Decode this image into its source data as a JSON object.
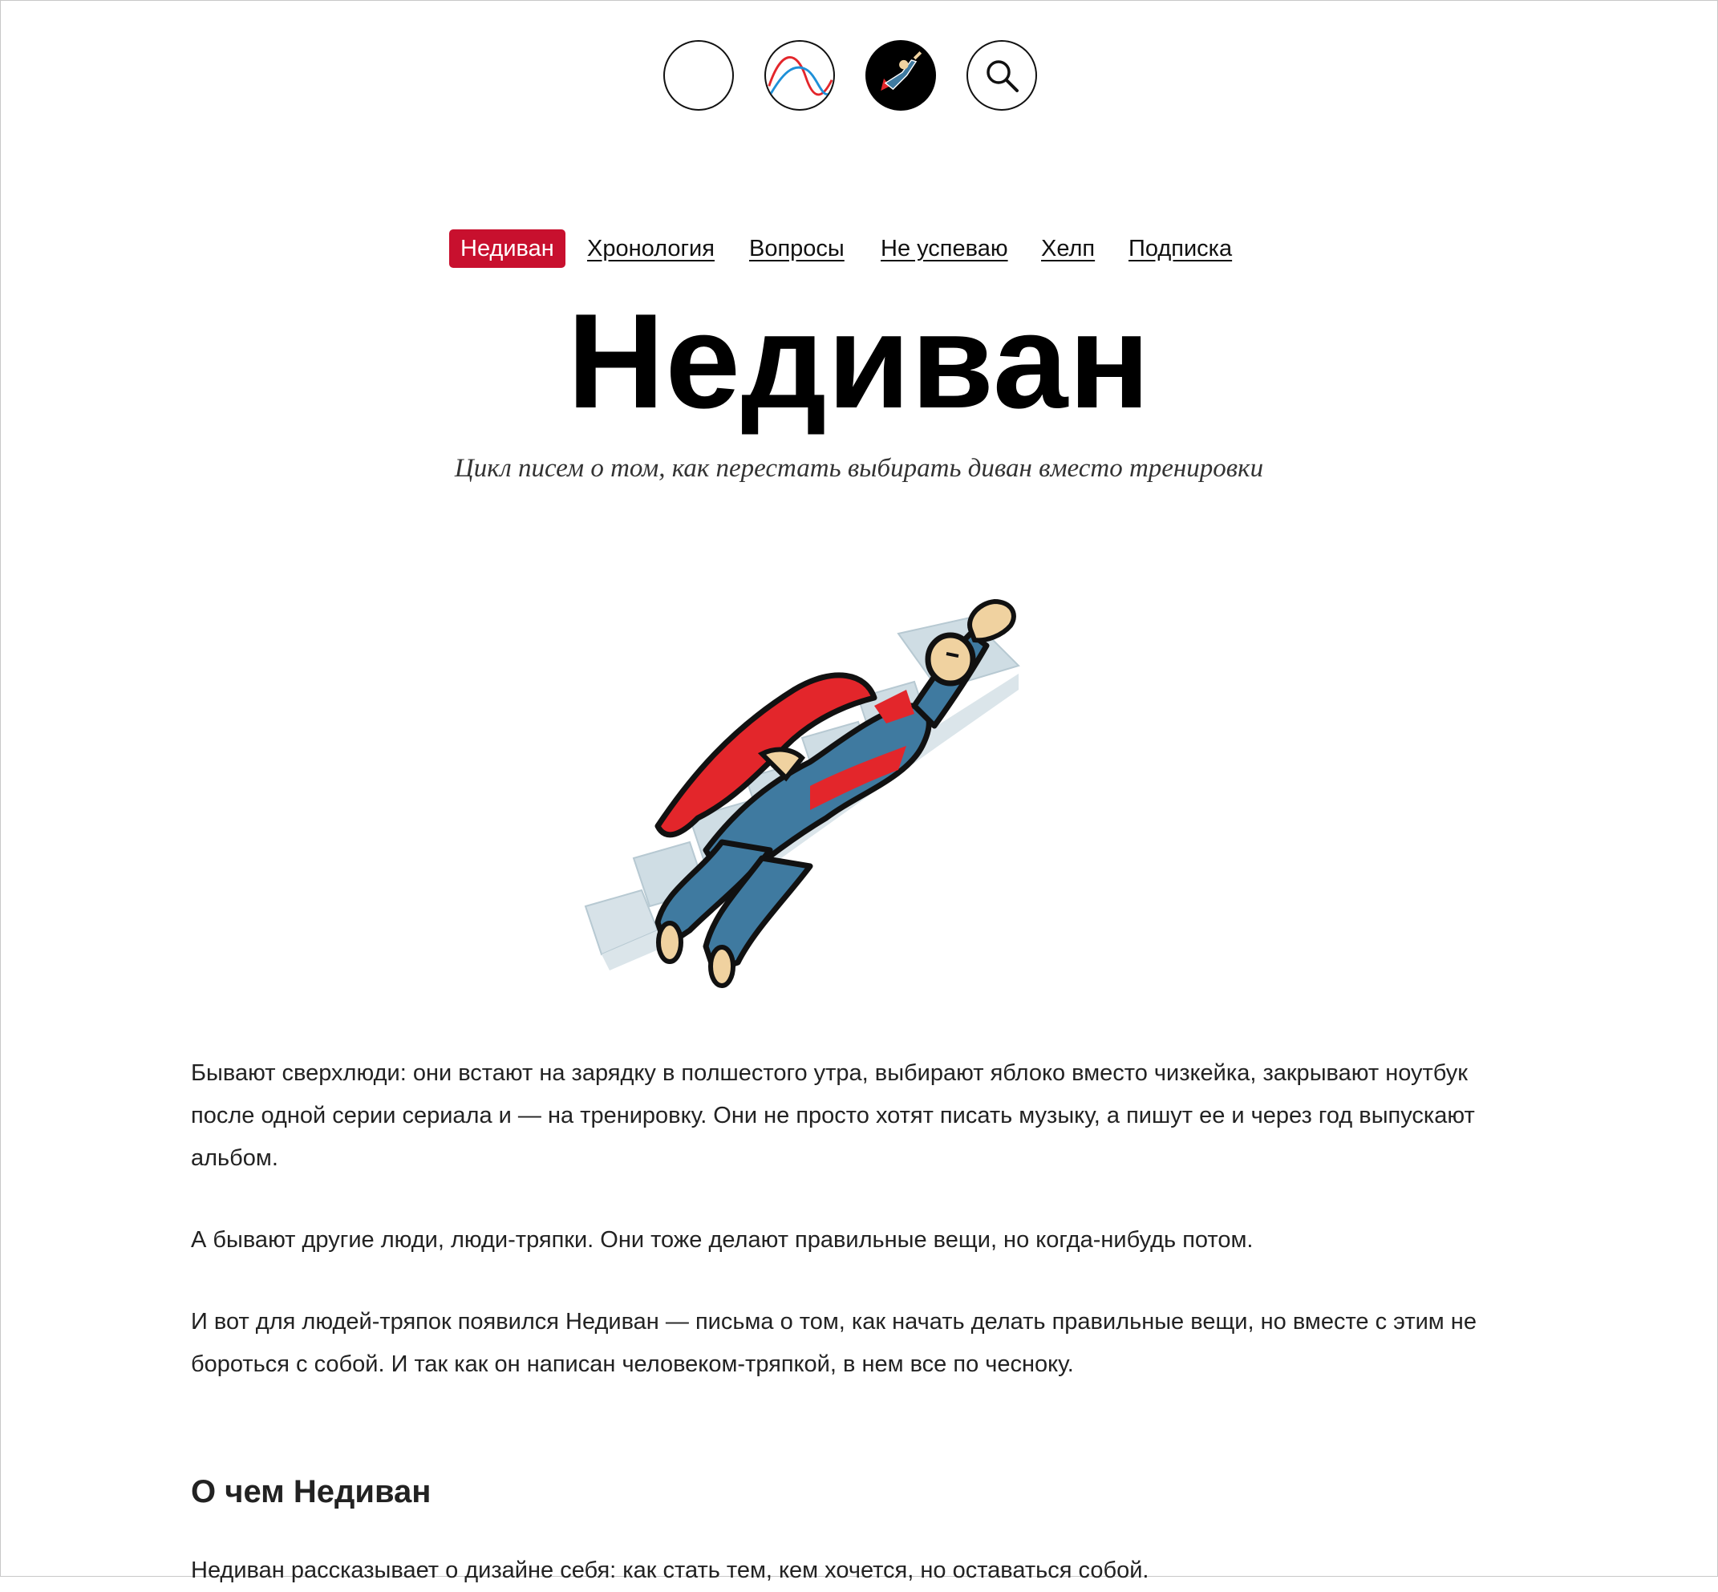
{
  "top_icons": [
    {
      "name": "blank-circle-icon"
    },
    {
      "name": "waves-chart-icon"
    },
    {
      "name": "superhero-icon"
    },
    {
      "name": "search-icon"
    }
  ],
  "nav": {
    "items": [
      {
        "label": "Недиван",
        "active": true
      },
      {
        "label": "Хронология"
      },
      {
        "label": "Вопросы"
      },
      {
        "label": "Не успеваю"
      },
      {
        "label": "Хелп"
      },
      {
        "label": "Подписка"
      }
    ]
  },
  "header": {
    "title": "Недиван",
    "subtitle": "Цикл писем о том, как перестать выбирать диван вместо тренировки"
  },
  "hero": {
    "image": "superhero-flying-up-stairs"
  },
  "content": {
    "p1": "Бывают сверхлюди: они встают на зарядку в полшестого утра, выбирают яблоко вместо чизкейка, закрывают ноутбук после одной серии сериала и — на тренировку. Они не просто хотят писать музыку, а пишут ее и через год выпускают альбом.",
    "p2": "А бывают другие люди, люди-тряпки. Они тоже делают правильные вещи, но когда-нибудь потом.",
    "p3": "И вот для людей-тряпок появился Недиван — письма о том, как начать делать правильные вещи, но вместе с этим не бороться с собой. И так как он написан человеком-тряпкой, в нем все по чесноку.",
    "h2": "О чем Недиван",
    "p4": "Недиван рассказывает о дизайне себя: как стать тем, кем хочется, но оставаться собой."
  },
  "colors": {
    "accent": "#c8102e",
    "text": "#222222"
  }
}
